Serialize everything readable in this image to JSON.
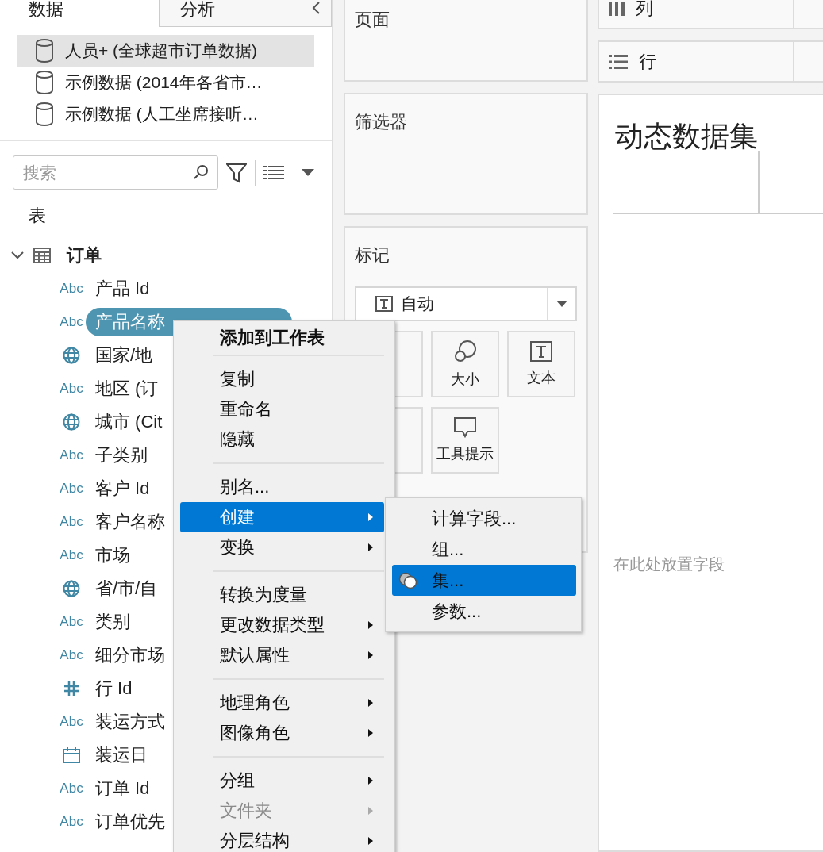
{
  "side_tabs": [
    {
      "label": "数据",
      "selected": true
    },
    {
      "label": "分析",
      "selected": false
    }
  ],
  "data_sources": [
    {
      "name": "人员+ (全球超市订单数据)",
      "selected": true
    },
    {
      "name": "示例数据 (2014年各省市…",
      "selected": false
    },
    {
      "name": "示例数据 (人工坐席接听…",
      "selected": false
    }
  ],
  "search": {
    "placeholder": "搜索"
  },
  "tables_heading": "表",
  "table": {
    "name": "订单",
    "expanded": true,
    "fields": [
      {
        "kind": "string",
        "type_label": "Abc",
        "name": "产品 Id",
        "selected": false
      },
      {
        "kind": "string",
        "type_label": "Abc",
        "name": "产品名称",
        "selected": true
      },
      {
        "kind": "geo",
        "name": "国家/地",
        "selected": false
      },
      {
        "kind": "string",
        "type_label": "Abc",
        "name": "地区 (订",
        "selected": false
      },
      {
        "kind": "geo",
        "name": "城市 (Cit",
        "selected": false
      },
      {
        "kind": "string",
        "type_label": "Abc",
        "name": "子类别",
        "selected": false
      },
      {
        "kind": "string",
        "type_label": "Abc",
        "name": "客户 Id",
        "selected": false
      },
      {
        "kind": "string",
        "type_label": "Abc",
        "name": "客户名称",
        "selected": false
      },
      {
        "kind": "string",
        "type_label": "Abc",
        "name": "市场",
        "selected": false
      },
      {
        "kind": "geo",
        "name": "省/市/自",
        "selected": false
      },
      {
        "kind": "string",
        "type_label": "Abc",
        "name": "类别",
        "selected": false
      },
      {
        "kind": "string",
        "type_label": "Abc",
        "name": "细分市场",
        "selected": false
      },
      {
        "kind": "number",
        "name": "行 Id",
        "selected": false
      },
      {
        "kind": "string",
        "type_label": "Abc",
        "name": "装运方式",
        "selected": false
      },
      {
        "kind": "date",
        "name": "装运日",
        "selected": false
      },
      {
        "kind": "string",
        "type_label": "Abc",
        "name": "订单 Id",
        "selected": false
      },
      {
        "kind": "string",
        "type_label": "Abc",
        "name": "订单优先",
        "selected": false
      }
    ]
  },
  "pages_shelf": {
    "title": "页面"
  },
  "filters_shelf": {
    "title": "筛选器"
  },
  "marks": {
    "title": "标记",
    "mark_type": "自动",
    "buttons": [
      {
        "kind": "size",
        "label": "大小"
      },
      {
        "kind": "text",
        "label": "文本"
      },
      {
        "kind": "tooltip",
        "label": "工具提示"
      }
    ]
  },
  "columns_shelf": {
    "label": "列"
  },
  "rows_shelf": {
    "label": "行"
  },
  "view": {
    "title": "动态数据集",
    "drop_hint": "在此处放置字段"
  },
  "context_menu": {
    "groups": [
      [
        {
          "label": "添加到工作表",
          "bold": true,
          "submenu": false,
          "disabled": false,
          "selected": false
        }
      ],
      [
        {
          "label": "复制",
          "bold": false,
          "submenu": false,
          "disabled": false,
          "selected": false
        },
        {
          "label": "重命名",
          "bold": false,
          "submenu": false,
          "disabled": false,
          "selected": false
        },
        {
          "label": "隐藏",
          "bold": false,
          "submenu": false,
          "disabled": false,
          "selected": false
        }
      ],
      [
        {
          "label": "别名...",
          "bold": false,
          "submenu": false,
          "disabled": false,
          "selected": false
        },
        {
          "label": "创建",
          "bold": false,
          "submenu": true,
          "disabled": false,
          "selected": true
        },
        {
          "label": "变换",
          "bold": false,
          "submenu": true,
          "disabled": false,
          "selected": false
        }
      ],
      [
        {
          "label": "转换为度量",
          "bold": false,
          "submenu": false,
          "disabled": false,
          "selected": false
        },
        {
          "label": "更改数据类型",
          "bold": false,
          "submenu": true,
          "disabled": false,
          "selected": false
        },
        {
          "label": "默认属性",
          "bold": false,
          "submenu": true,
          "disabled": false,
          "selected": false
        }
      ],
      [
        {
          "label": "地理角色",
          "bold": false,
          "submenu": true,
          "disabled": false,
          "selected": false
        },
        {
          "label": "图像角色",
          "bold": false,
          "submenu": true,
          "disabled": false,
          "selected": false
        }
      ],
      [
        {
          "label": "分组",
          "bold": false,
          "submenu": true,
          "disabled": false,
          "selected": false
        },
        {
          "label": "文件夹",
          "bold": false,
          "submenu": true,
          "disabled": true,
          "selected": false
        },
        {
          "label": "分层结构",
          "bold": false,
          "submenu": true,
          "disabled": false,
          "selected": false
        }
      ]
    ]
  },
  "submenu": {
    "items": [
      {
        "label": "计算字段...",
        "selected": false,
        "icon": false
      },
      {
        "label": "组...",
        "selected": false,
        "icon": false
      },
      {
        "label": "集...",
        "selected": true,
        "icon": true
      },
      {
        "label": "参数...",
        "selected": false,
        "icon": false
      }
    ]
  }
}
